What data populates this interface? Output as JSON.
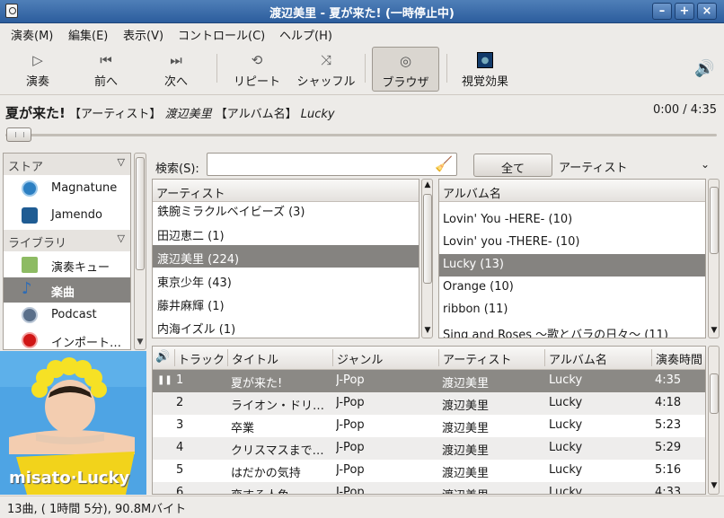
{
  "window": {
    "title": "渡辺美里 - 夏が来た! (一時停止中)"
  },
  "menu": [
    "演奏(M)",
    "編集(E)",
    "表示(V)",
    "コントロール(C)",
    "ヘルプ(H)"
  ],
  "toolbar": {
    "play": "演奏",
    "prev": "前へ",
    "next": "次へ",
    "repeat": "リピート",
    "shuffle": "シャッフル",
    "browser": "ブラウザ",
    "visual": "視覚効果"
  },
  "now_playing": {
    "song": "夏が来た!",
    "artist_label": "【アーティスト】",
    "artist": "渡辺美里",
    "album_label": "【アルバム名】",
    "album": "Lucky",
    "time": "0:00 / 4:35"
  },
  "sidebar": {
    "store_header": "ストア",
    "store_items": [
      "Magnatune",
      "Jamendo"
    ],
    "library_header": "ライブラリ",
    "library_items": [
      "演奏キュー",
      "楽曲",
      "Podcast",
      "インポート…"
    ]
  },
  "cover": {
    "text": "misato·Lucky"
  },
  "search": {
    "label": "検索(S):",
    "value": "",
    "all_button": "全て",
    "filter": "アーティスト"
  },
  "artists": {
    "header": "アーティスト",
    "rows": [
      "鉄腕ミラクルベイビーズ (3)",
      "田辺恵二 (1)",
      "渡辺美里 (224)",
      "東京少年 (43)",
      "藤井麻輝 (1)",
      "内海イズル (1)"
    ]
  },
  "albums": {
    "header": "アルバム名",
    "rows": [
      "Lovin' You -HERE- (10)",
      "Lovin' you -THERE- (10)",
      "Lucky (13)",
      "Orange (10)",
      "ribbon (11)",
      "Sing and Roses ～歌とバラの日々～ (11)"
    ]
  },
  "tracks": {
    "headers": [
      "トラック",
      "タイトル",
      "ジャンル",
      "アーティスト",
      "アルバム名",
      "演奏時間"
    ],
    "rows": [
      [
        "1",
        "夏が来た!",
        "J-Pop",
        "渡辺美里",
        "Lucky",
        "4:35"
      ],
      [
        "2",
        "ライオン・ドリ…",
        "J-Pop",
        "渡辺美里",
        "Lucky",
        "4:18"
      ],
      [
        "3",
        "卒業",
        "J-Pop",
        "渡辺美里",
        "Lucky",
        "5:23"
      ],
      [
        "4",
        "クリスマスまで…",
        "J-Pop",
        "渡辺美里",
        "Lucky",
        "5:29"
      ],
      [
        "5",
        "はだかの気持",
        "J-Pop",
        "渡辺美里",
        "Lucky",
        "5:16"
      ],
      [
        "6",
        "恋する人魚",
        "J-Pop",
        "渡辺美里",
        "Lucky",
        "4:33"
      ]
    ]
  },
  "status": "13曲, ( 1時間 5分), 90.8Mバイト"
}
